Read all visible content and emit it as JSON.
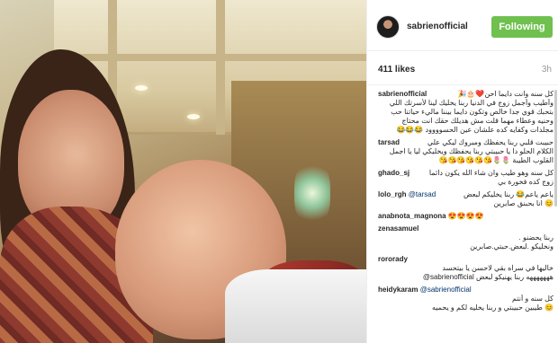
{
  "post": {
    "username": "sabrienofficial",
    "follow_label": "Following",
    "likes": "411 likes",
    "time": "3h"
  },
  "comments": [
    {
      "user": "sabrienofficial",
      "lines": [
        "كل سنه وانت دايما احن❤️🎂🎉",
        "وأطيب وأجمل زوج في الدنيا ربنا يخليك لينا لأسرتك اللي",
        "بتحبك قوي جدا خالص وتكون دايما بيننا ماليء حياتنا حب",
        "وحنيه وعطاء مهما قلت مش هديلك حقك انت محتاج",
        "مجلدات وكفايه كده علشان عين الحسوووود 😂😂😂"
      ]
    },
    {
      "user": "tarsad",
      "lines": [
        "حبيبت قلبي ربنا يحفظك ومبروك ليكي علي",
        "الكلام الحلو دا يا حبيبتي ربنا يحفظك ويخليكي ليا يا اجمل",
        "القلوب الطيبة 🌷🌷😘😘😘😘😘😘"
      ]
    },
    {
      "user": "ghado_sj",
      "lines": [
        "كل سنه وهو طيب وان شاء الله يكون دائما",
        "زوج كده فخورة بي"
      ]
    },
    {
      "user": "lolo_rgh",
      "mention": "@tarsad",
      "lines": [
        "ياعم ياعم😂 ربنا يخليكم لبعض",
        "😊 انا بحبنق صابرين"
      ]
    },
    {
      "user": "anabnota_magnona",
      "lines": [
        "😍😍😍😍"
      ]
    },
    {
      "user": "zenasamuel",
      "lines": [
        "ربنا يحضنو .",
        "ونخليكو .لبعض.حبتي.صابرين"
      ]
    },
    {
      "user": "rororady",
      "lines": [
        "خاليها في سراه بقي لاحسن يا بيتحسد",
        "@sabrienofficial هههههههه ربنا يهنيكو لبعض"
      ]
    },
    {
      "user": "heidykaram",
      "mention": "@sabrienofficial",
      "lines": [
        "كل سنه و أنتم",
        "😊 طيبين حبيبتي و ربنا يخليه لكم و يحميه"
      ]
    }
  ]
}
